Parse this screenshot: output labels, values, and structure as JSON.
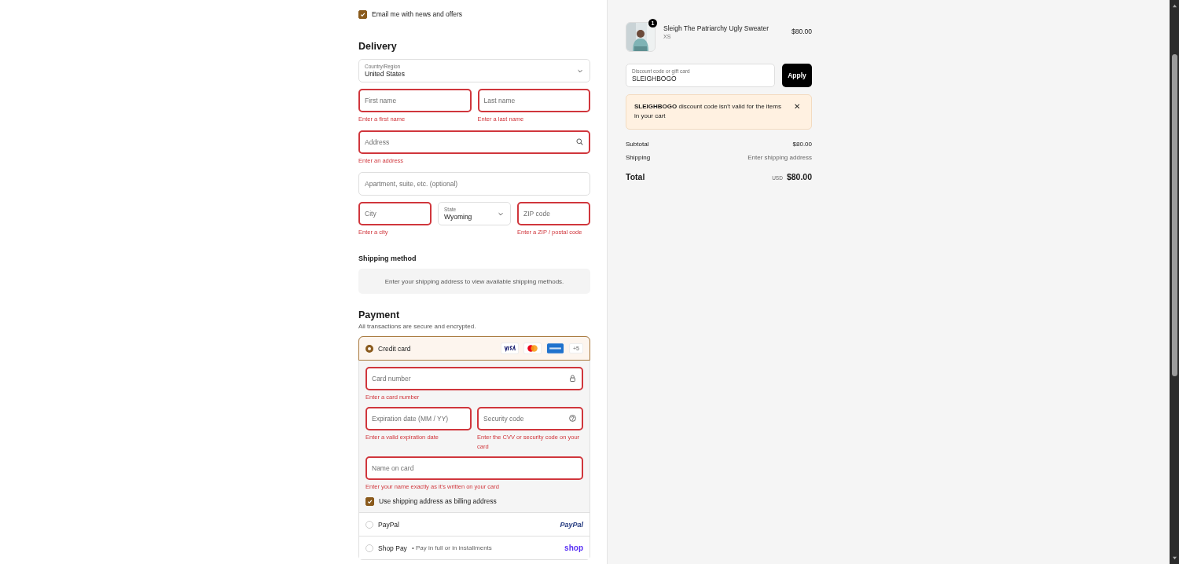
{
  "marketing": {
    "label": "Email me with news and offers",
    "checked": true
  },
  "delivery": {
    "heading": "Delivery",
    "rows": [
      [
        {
          "kind": "select",
          "label": "Country/Region",
          "value": "United States"
        }
      ],
      [
        {
          "kind": "text",
          "placeholder": "First name",
          "error": "Enter a first name"
        },
        {
          "kind": "text",
          "placeholder": "Last name",
          "error": "Enter a last name"
        }
      ],
      [
        {
          "kind": "address",
          "placeholder": "Address",
          "error": "Enter an address"
        }
      ],
      [
        {
          "kind": "text",
          "placeholder": "Apartment, suite, etc. (optional)"
        }
      ],
      [
        {
          "kind": "text",
          "placeholder": "City",
          "error": "Enter a city"
        },
        {
          "kind": "select",
          "label": "State",
          "value": "Wyoming"
        },
        {
          "kind": "text",
          "placeholder": "ZIP code",
          "error": "Enter a ZIP / postal code"
        }
      ]
    ]
  },
  "shipping_method": {
    "heading": "Shipping method",
    "message": "Enter your shipping address to view available shipping methods."
  },
  "payment": {
    "heading": "Payment",
    "subtitle": "All transactions are secure and encrypted.",
    "methods": [
      {
        "kind": "card",
        "label": "Credit card",
        "selected": true,
        "more": "+5",
        "rows": [
          [
            {
              "kind": "card_number",
              "placeholder": "Card number",
              "error": "Enter a card number"
            }
          ],
          [
            {
              "kind": "text",
              "placeholder": "Expiration date (MM / YY)",
              "error": "Enter a valid expiration date"
            },
            {
              "kind": "security_code",
              "placeholder": "Security code",
              "error": "Enter the CVV or security code on your card"
            }
          ],
          [
            {
              "kind": "text",
              "placeholder": "Name on card",
              "error": "Enter your name exactly as it's written on your card"
            }
          ]
        ],
        "billing": {
          "label": "Use shipping address as billing address",
          "checked": true
        }
      },
      {
        "kind": "paypal",
        "label": "PayPal",
        "selected": false,
        "logo": "PayPal"
      },
      {
        "kind": "shoppay",
        "label": "Shop Pay",
        "note": "• Pay in full or in installments",
        "selected": false,
        "logo": "shop"
      }
    ]
  },
  "summary": {
    "item": {
      "name": "Sleigh The Patriarchy Ugly Sweater",
      "variant": "XS",
      "price": "$80.00",
      "quantity": "1"
    },
    "discount": {
      "label": "Discount code or gift card",
      "value": "SLEIGHBOGO",
      "button": "Apply"
    },
    "alert": {
      "code": "SLEIGHBOGO",
      "message": " discount code isn't valid for the items in your cart",
      "close": "✕"
    },
    "lines": [
      {
        "label": "Subtotal",
        "value": "$80.00"
      },
      {
        "label": "Shipping",
        "value": "Enter shipping address"
      }
    ],
    "total": {
      "label": "Total",
      "currency": "USD",
      "value": "$80.00"
    }
  }
}
